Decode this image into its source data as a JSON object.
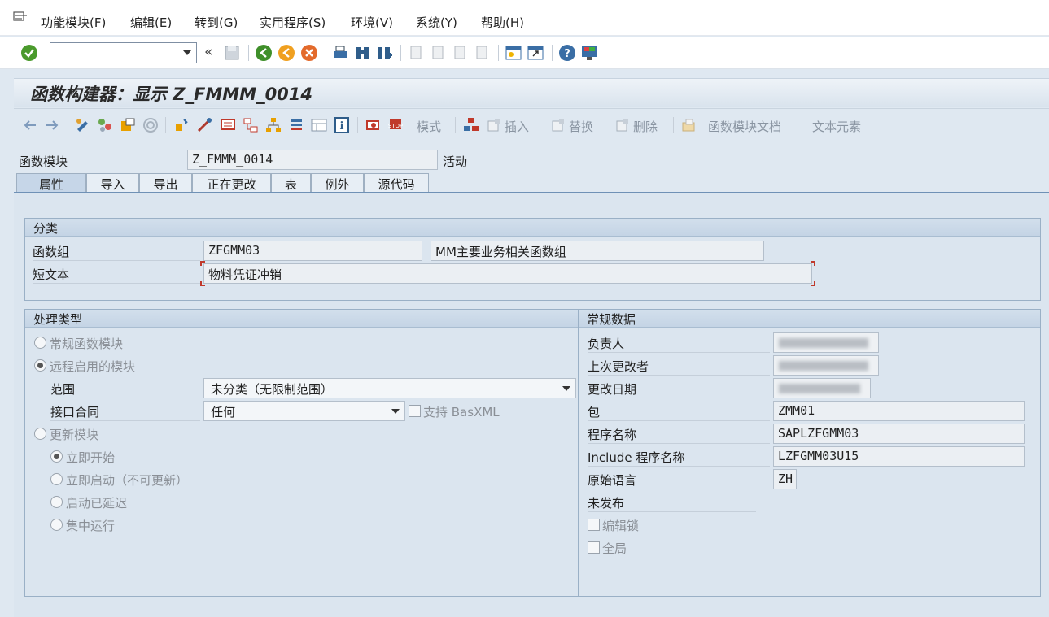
{
  "menu": {
    "items": [
      "功能模块(F)",
      "编辑(E)",
      "转到(G)",
      "实用程序(S)",
      "环境(V)",
      "系统(Y)",
      "帮助(H)"
    ]
  },
  "toolbar": {
    "command_value": "",
    "back_chevron": "«"
  },
  "title": "函数构建器：显示 Z_FMMM_0014",
  "app_toolbar": {
    "mode_label": "模式",
    "insert_label": "插入",
    "replace_label": "替换",
    "delete_label": "删除",
    "fm_doc_label": "函数模块文档",
    "text_elements_label": "文本元素"
  },
  "header": {
    "fm_label": "函数模块",
    "fm_value": "Z_FMMM_0014",
    "status": "活动"
  },
  "tabs": [
    "属性",
    "导入",
    "导出",
    "正在更改",
    "表",
    "例外",
    "源代码"
  ],
  "classification": {
    "title": "分类",
    "group_label": "函数组",
    "group_value": "ZFGMM03",
    "group_desc": "MM主要业务相关函数组",
    "short_text_label": "短文本",
    "short_text_value": "物料凭证冲销"
  },
  "processing": {
    "title": "处理类型",
    "normal": "常规函数模块",
    "remote": "远程启用的模块",
    "scope_label": "范围",
    "scope_value": "未分类（无限制范围）",
    "interface_label": "接口合同",
    "interface_value": "任何",
    "basxml_label": "支持 BasXML",
    "update": "更新模块",
    "start_immediate": "立即开始",
    "start_immediate_no_update": "立即启动（不可更新）",
    "start_delayed": "启动已延迟",
    "collective_run": "集中运行"
  },
  "general": {
    "title": "常规数据",
    "responsible_label": "负责人",
    "last_changed_by_label": "上次更改者",
    "changed_on_label": "更改日期",
    "package_label": "包",
    "package_value": "ZMM01",
    "program_label": "程序名称",
    "program_value": "SAPLZFGMM03",
    "include_label": "Include 程序名称",
    "include_value": "LZFGMM03U15",
    "language_label": "原始语言",
    "language_value": "ZH",
    "release_status": "未发布",
    "edit_lock_label": "编辑锁",
    "global_label": "全局"
  }
}
